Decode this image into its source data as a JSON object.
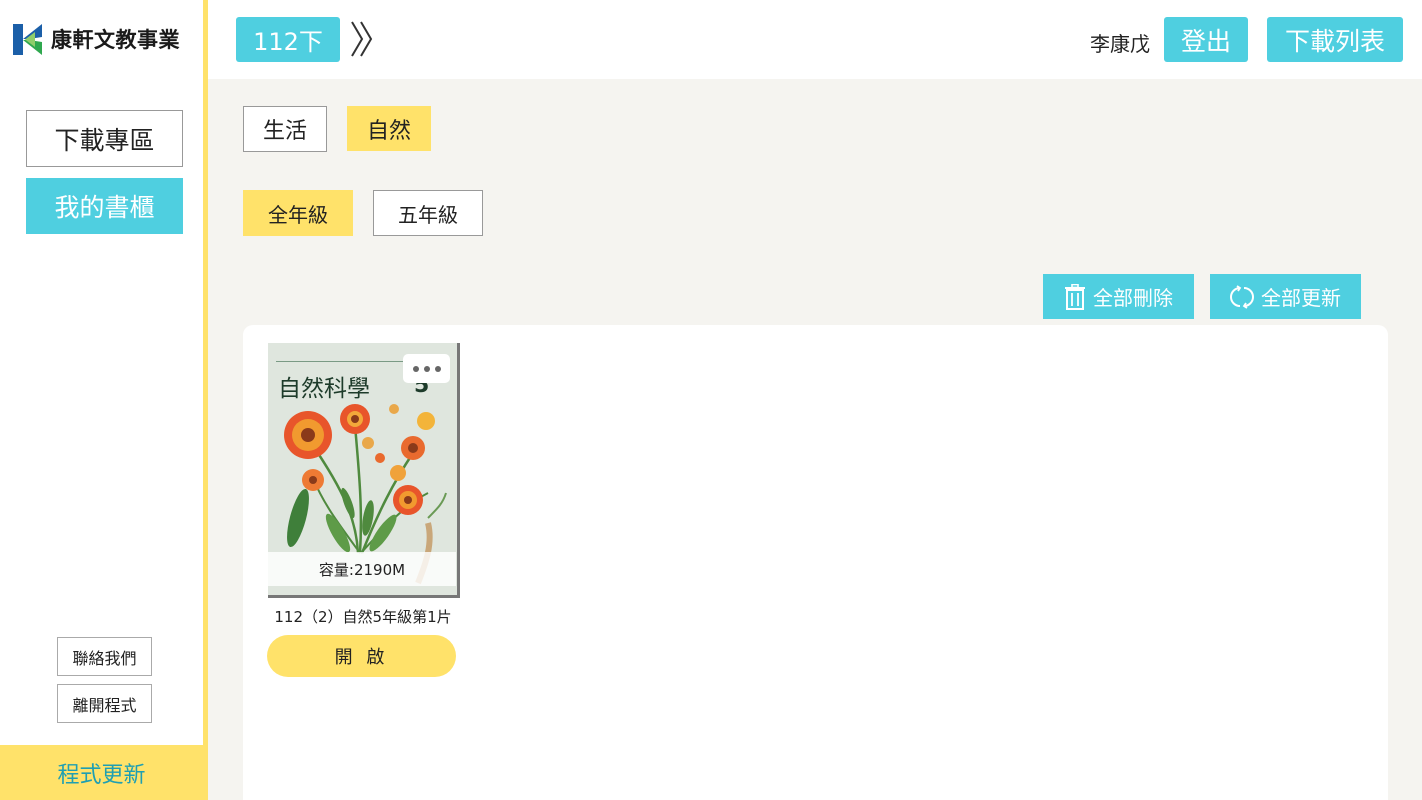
{
  "sidebar": {
    "logo_text": "康軒文教事業",
    "nav": [
      {
        "label": "下載專區"
      },
      {
        "label": "我的書櫃"
      }
    ],
    "contact_label": "聯絡我們",
    "exit_label": "離開程式",
    "update_label": "程式更新"
  },
  "header": {
    "semester": "112下",
    "username": "李康戊",
    "logout_label": "登出",
    "download_list_label": "下載列表"
  },
  "filters": {
    "subjects": [
      {
        "label": "生活",
        "selected": false
      },
      {
        "label": "自然",
        "selected": true
      }
    ],
    "grades": [
      {
        "label": "全年級",
        "selected": true
      },
      {
        "label": "五年級",
        "selected": false
      }
    ]
  },
  "actions": {
    "delete_all_label": "全部刪除",
    "update_all_label": "全部更新"
  },
  "books": [
    {
      "cover_title": "自然科學",
      "cover_grade": "5",
      "capacity": "容量:2190M",
      "title": "112（2）自然5年級第1片",
      "open_label": "開 啟"
    }
  ],
  "colors": {
    "accent_cyan": "#4fcfe0",
    "accent_yellow": "#ffe26a",
    "background": "#f5f4f0"
  }
}
